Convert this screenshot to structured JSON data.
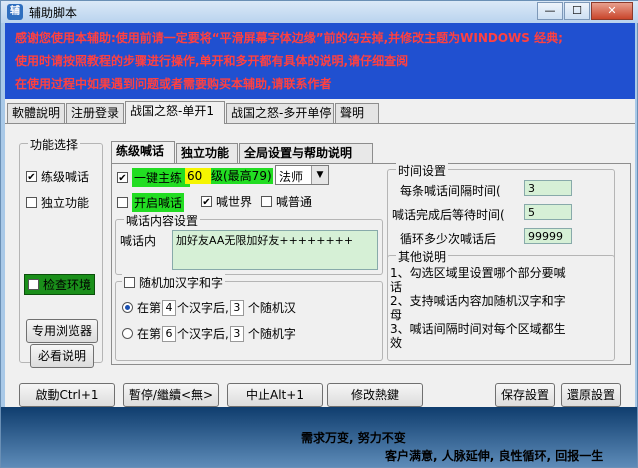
{
  "window": {
    "title": "辅助脚本",
    "controls": [
      "—",
      "☐",
      "✕"
    ]
  },
  "notice": [
    "感谢您使用本辅助:使用前请一定要将“平滑屏幕字体边缘”前的勾去掉,并修改主题为WINDOWS 经典;",
    "使用时请按照教程的步骤进行操作,单开和多开都有具体的说明,请仔细查阅",
    "在使用过程中如果遇到问题或者需要购买本辅助,请联系作者"
  ],
  "tabs": [
    "軟體說明",
    "注册登录",
    "战国之怒-单开1",
    "战国之怒-多开单停",
    "聲明"
  ],
  "active_tab": 2,
  "func_select": {
    "label": "功能选择",
    "items": [
      {
        "label": "练级喊话",
        "checked": true
      },
      {
        "label": "独立功能",
        "checked": false
      }
    ],
    "check_env": "检查环境",
    "btn_browser": "专用浏览器",
    "btn_readme": "必看说明"
  },
  "sub_tabs": [
    "练级喊话",
    "独立功能",
    "全局设置与帮助说明"
  ],
  "shout": {
    "one_key": {
      "label": "一键主练",
      "level": "60",
      "level_label": "级(最高79)",
      "checked": true
    },
    "job": "法师",
    "open_shout": {
      "label": "开启喊话",
      "checked": false
    },
    "world": {
      "label": "喊世界",
      "checked": true
    },
    "normal": {
      "label": "喊普通",
      "checked": false
    },
    "content_group": "喊话内容设置",
    "content_label": "喊话内",
    "content_value": "加好友AA无限加好友++++++++",
    "random_group": "随机加汉字和字",
    "random_checked": false,
    "opt1": {
      "prefix": "在第",
      "num": "4",
      "mid": "个汉字后,",
      "count": "3",
      "suffix": "个随机汉"
    },
    "opt2": {
      "prefix": "在第",
      "num": "6",
      "mid": "个汉字后,",
      "count": "3",
      "suffix": "个随机字"
    }
  },
  "time_settings": {
    "label": "时间设置",
    "rows": [
      {
        "label": "每条喊话间隔时间(",
        "value": "3"
      },
      {
        "label": "喊话完成后等待时间(",
        "value": "5"
      },
      {
        "label": "循环多少次喊话后",
        "value": "99999"
      }
    ]
  },
  "other_notes": {
    "label": "其他说明",
    "lines": [
      "1、勾选区域里设置哪个部分要喊",
      "话",
      "2、支持喊话内容加随机汉字和字",
      "母",
      "3、喊话间隔时间对每个区域都生",
      "效"
    ]
  },
  "bottom_buttons": [
    "啟動Ctrl+1",
    "暫停/繼續<無>",
    "中止Alt+1",
    "修改熱鍵",
    "保存設置",
    "還原設置"
  ],
  "footer": {
    "line1": "需求万变, 努力不变",
    "line2": "客户满意, 人脉延伸, 良性循环, 回报一生"
  },
  "colors": {
    "notice_bg": "#2050d0",
    "notice_text": "#ff4040",
    "footer_bg": "#0f3d6e",
    "green_hl": "#22dd22",
    "yellow_hl": "#f5f500"
  }
}
